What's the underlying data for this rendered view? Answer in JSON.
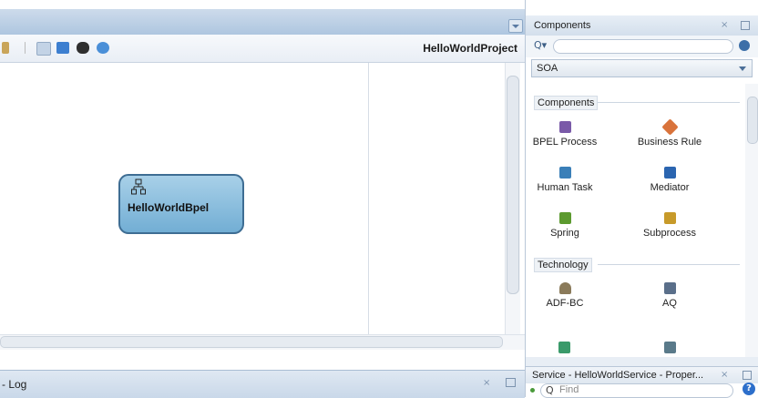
{
  "editor": {
    "project_name": "HelloWorldProject",
    "node_label": "HelloWorldBpel"
  },
  "log_panel": {
    "label": "- Log",
    "close": "×"
  },
  "components_panel": {
    "title": "Components",
    "close": "×",
    "search_value": "",
    "category": "SOA",
    "sections": [
      {
        "name": "Components",
        "items": [
          {
            "label": "BPEL Process",
            "icon": "bpel-process-icon",
            "color": "#7a5aa8"
          },
          {
            "label": "Business Rule",
            "icon": "business-rule-icon",
            "color": "#d9733b"
          },
          {
            "label": "Human Task",
            "icon": "human-task-icon",
            "color": "#3a7fb8"
          },
          {
            "label": "Mediator",
            "icon": "mediator-icon",
            "color": "#2b65b0"
          },
          {
            "label": "Spring",
            "icon": "spring-icon",
            "color": "#5c9a2f"
          },
          {
            "label": "Subprocess",
            "icon": "subprocess-icon",
            "color": "#c79a2a"
          }
        ]
      },
      {
        "name": "Technology",
        "items": [
          {
            "label": "ADF-BC",
            "icon": "adf-bc-icon",
            "color": "#8a7a5a"
          },
          {
            "label": "AQ",
            "icon": "aq-icon",
            "color": "#5a6f8a"
          }
        ]
      }
    ]
  },
  "properties_panel": {
    "title": "Service - HelloWorldService - Proper...",
    "close": "×",
    "find_placeholder": "Find",
    "help": "?"
  },
  "colors": {
    "titlebar": "#aec6e0",
    "bpel_fill": "#8fc0de",
    "bpel_border": "#3e6d93"
  }
}
